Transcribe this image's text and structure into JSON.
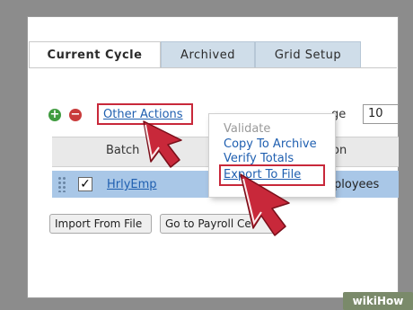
{
  "tabs": [
    {
      "label": "Current Cycle",
      "active": true
    },
    {
      "label": "Archived",
      "active": false
    },
    {
      "label": "Grid Setup",
      "active": false
    }
  ],
  "toolbar": {
    "add_icon": "plus-icon",
    "remove_icon": "minus-icon",
    "other_actions_label": "Other Actions",
    "page_label_partial": "ge",
    "page_size_value": "10"
  },
  "table": {
    "headers": {
      "batch": "Batch",
      "description_partial": "on"
    },
    "rows": [
      {
        "checked": true,
        "batch": "HrlyEmp",
        "description_partial": "ployees"
      }
    ]
  },
  "buttons": {
    "import_label": "Import From File",
    "payroll_label": "Go to Payroll Ce"
  },
  "menu": {
    "items": [
      {
        "label": "Validate",
        "enabled": false
      },
      {
        "label": "Copy To Archive",
        "enabled": true
      },
      {
        "label": "Verify Totals",
        "enabled": true
      },
      {
        "label": "Export To File",
        "enabled": true,
        "highlighted": true
      }
    ]
  },
  "highlight_color": "#c8283a",
  "link_color": "#1f5fb0",
  "watermark": "wikiHow"
}
